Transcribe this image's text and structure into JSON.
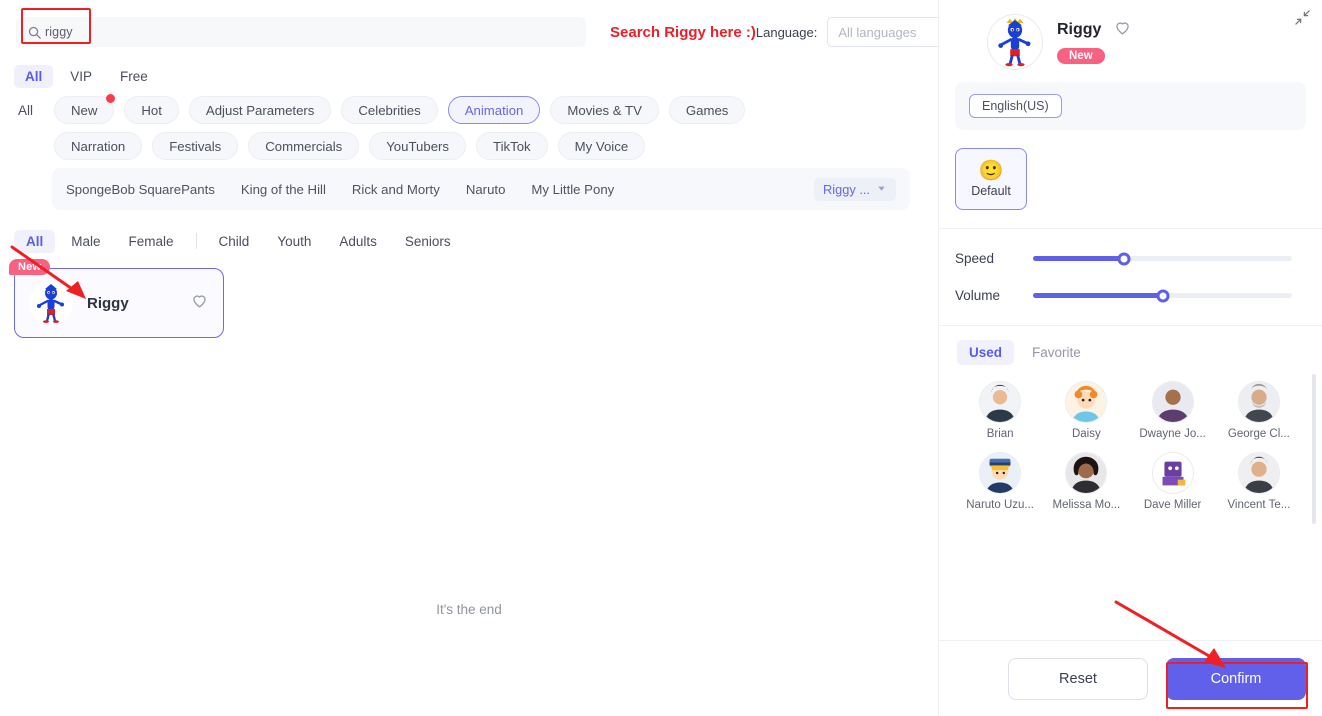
{
  "search": {
    "value": "riggy",
    "icon": "search-icon",
    "hint": "Search Riggy here :)"
  },
  "language_filter": {
    "label": "Language:",
    "value": "All languages",
    "chevron": "chevron-down-icon"
  },
  "top_tabs": [
    {
      "label": "All",
      "active": true
    },
    {
      "label": "VIP",
      "active": false
    },
    {
      "label": "Free",
      "active": false
    }
  ],
  "category_rows": {
    "all_label": "All",
    "row1": [
      {
        "label": "New",
        "selected": false,
        "dot": true
      },
      {
        "label": "Hot",
        "selected": false,
        "dot": false
      },
      {
        "label": "Adjust Parameters",
        "selected": false,
        "dot": false
      },
      {
        "label": "Celebrities",
        "selected": false,
        "dot": false
      },
      {
        "label": "Animation",
        "selected": true,
        "dot": false
      },
      {
        "label": "Movies & TV",
        "selected": false,
        "dot": false
      },
      {
        "label": "Games",
        "selected": false,
        "dot": false
      }
    ],
    "row2": [
      {
        "label": "Narration",
        "selected": false,
        "dot": false
      },
      {
        "label": "Festivals",
        "selected": false,
        "dot": false
      },
      {
        "label": "Commercials",
        "selected": false,
        "dot": false
      },
      {
        "label": "YouTubers",
        "selected": false,
        "dot": false
      },
      {
        "label": "TikTok",
        "selected": false,
        "dot": false
      },
      {
        "label": "My Voice",
        "selected": false,
        "dot": false
      }
    ]
  },
  "subcategories": {
    "items": [
      "SpongeBob SquarePants",
      "King of the Hill",
      "Rick and Morty",
      "Naruto",
      "My Little Pony"
    ],
    "more_label": "Riggy ...",
    "more_icon": "chevron-down-icon"
  },
  "gender_tabs": [
    {
      "label": "All",
      "active": true
    },
    {
      "label": "Male",
      "active": false
    },
    {
      "label": "Female",
      "active": false
    },
    {
      "label": "Child",
      "active": false
    },
    {
      "label": "Youth",
      "active": false
    },
    {
      "label": "Adults",
      "active": false
    },
    {
      "label": "Seniors",
      "active": false
    }
  ],
  "voice_cards": [
    {
      "name": "Riggy",
      "badge": "New",
      "favorite_icon": "heart-icon",
      "selected": true
    }
  ],
  "list_end_text": "It's the end",
  "detail_panel": {
    "collapse_icon": "collapse-icon",
    "name": "Riggy",
    "favorite_icon": "heart-icon",
    "badge": "New",
    "language_chip": "English(US)",
    "emotion": {
      "label": "Default",
      "emoji": "🙂"
    },
    "sliders": [
      {
        "label": "Speed",
        "percent": 35
      },
      {
        "label": "Volume",
        "percent": 50
      }
    ],
    "voice_tabs": [
      {
        "label": "Used",
        "active": true
      },
      {
        "label": "Favorite",
        "active": false
      }
    ],
    "voice_items": [
      {
        "name": "Brian"
      },
      {
        "name": "Daisy"
      },
      {
        "name": "Dwayne Jo..."
      },
      {
        "name": "George Cl..."
      },
      {
        "name": "Naruto Uzu..."
      },
      {
        "name": "Melissa Mo..."
      },
      {
        "name": "Dave Miller"
      },
      {
        "name": "Vincent Te..."
      }
    ],
    "actions": {
      "reset": "Reset",
      "confirm": "Confirm"
    }
  },
  "colors": {
    "accent": "#6160ea",
    "accent_soft": "#f1f1fd",
    "badge_pink": "#fa6080",
    "annotation_red": "#ef2024",
    "dot_red": "#fb3a4a"
  }
}
